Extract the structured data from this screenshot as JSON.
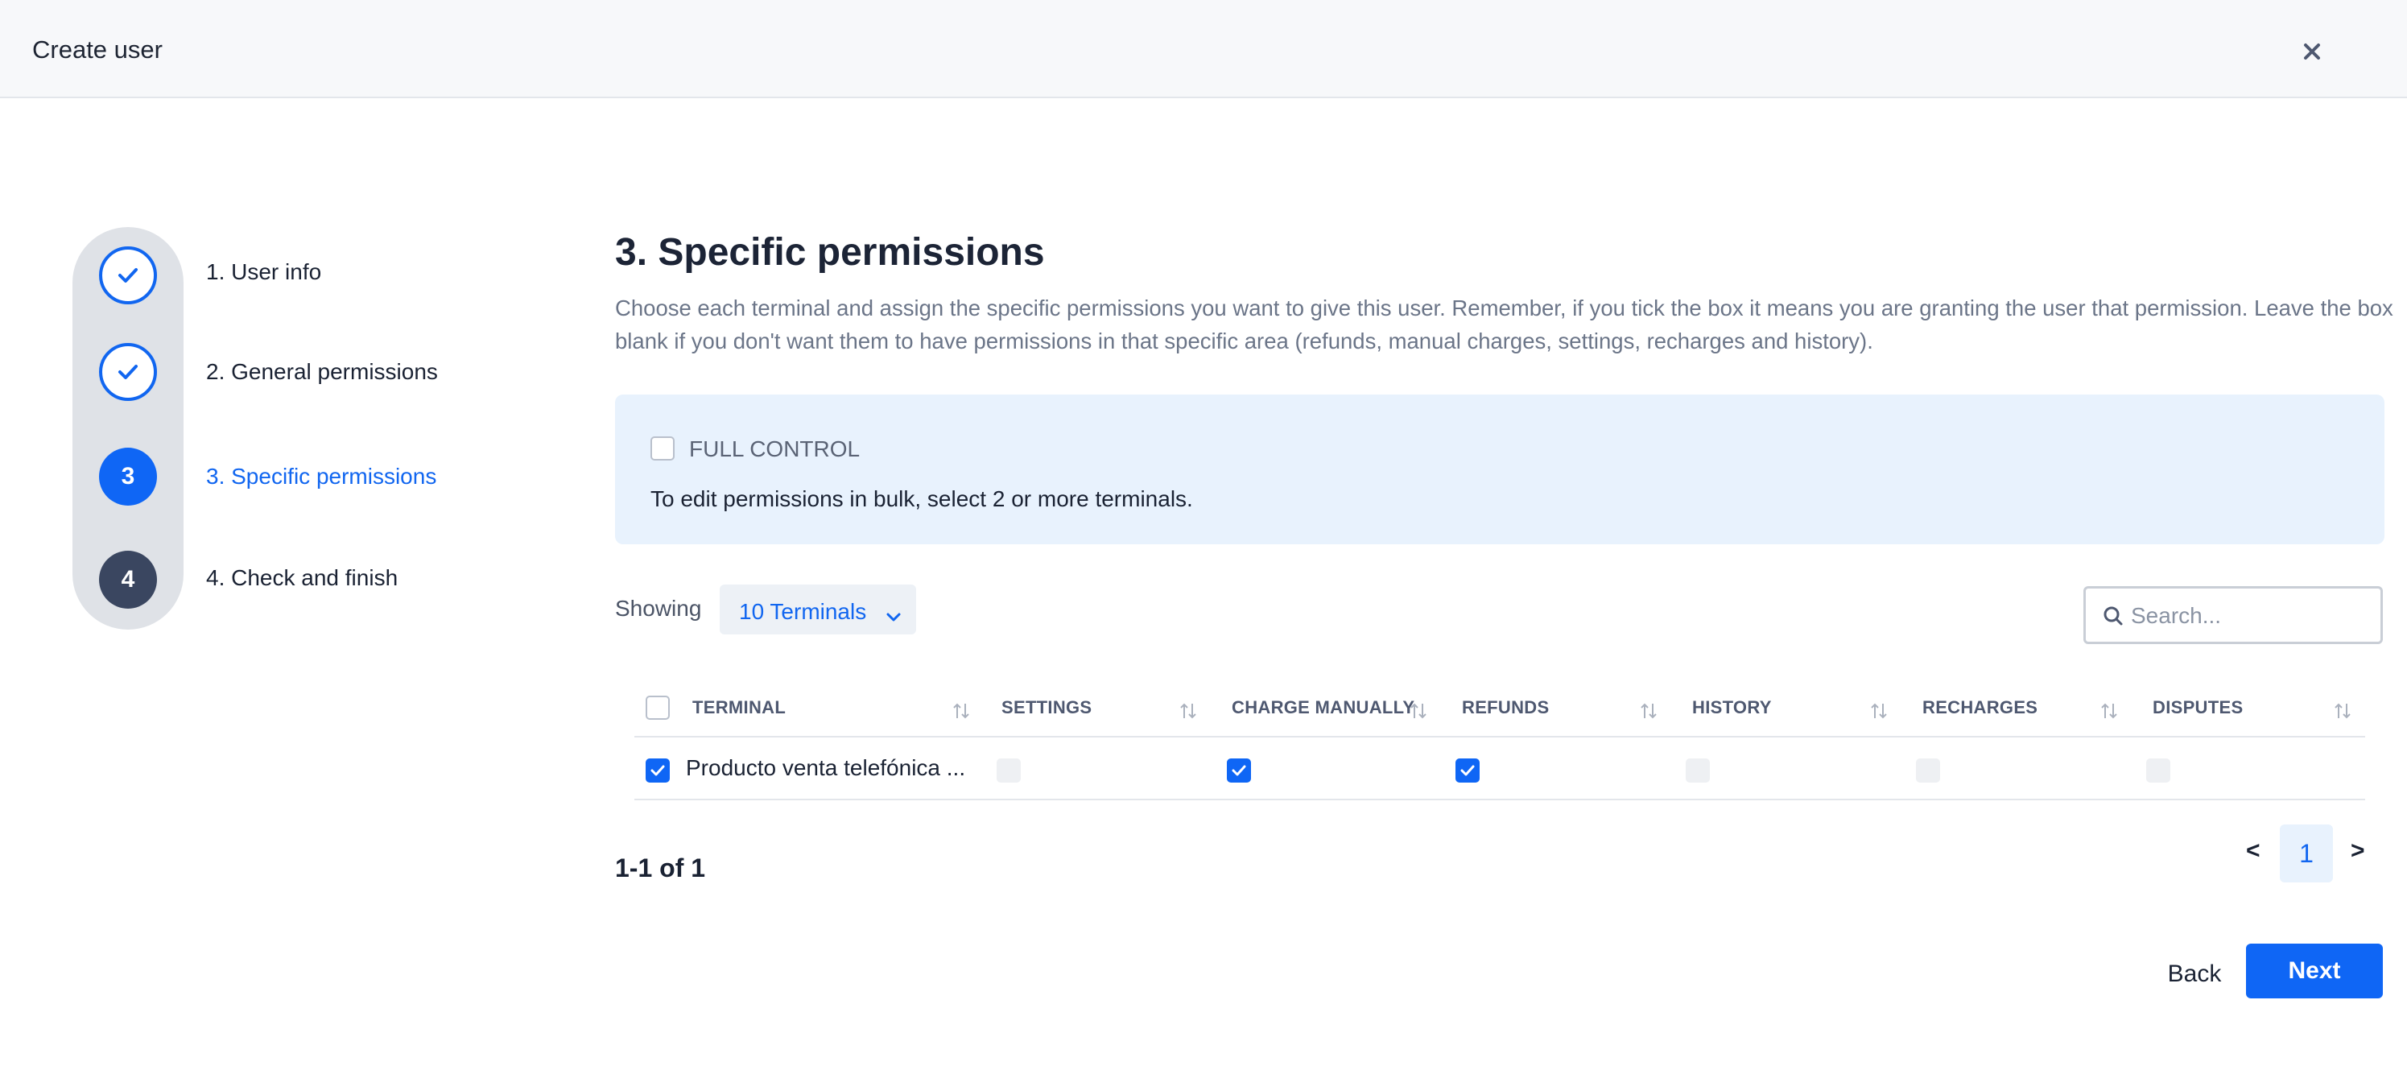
{
  "header": {
    "title": "Create user",
    "close_icon": "close-icon"
  },
  "colors": {
    "accent": "#0f66f5",
    "pending_step": "#3a4660",
    "info_bg": "#e8f2fd"
  },
  "stepper": {
    "steps": [
      {
        "number": "1",
        "label": "1. User info",
        "state": "done"
      },
      {
        "number": "2",
        "label": "2. General permissions",
        "state": "done"
      },
      {
        "number": "3",
        "label": "3. Specific permissions",
        "state": "active"
      },
      {
        "number": "4",
        "label": "4. Check and finish",
        "state": "pending"
      }
    ]
  },
  "main": {
    "title": "3. Specific permissions",
    "description": "Choose each terminal and assign the specific permissions you want to give this user. Remember, if you tick the box it means you are granting the user that permission. Leave the box blank if you don't want them to have permissions in that specific area (refunds, manual charges, settings, recharges and history).",
    "full_control": {
      "label": "FULL CONTROL",
      "checked": false
    },
    "bulk_text": "To edit permissions in bulk, select 2 or more terminals.",
    "showing_label": "Showing",
    "terminals_select": "10 Terminals",
    "search": {
      "placeholder": "Search...",
      "value": ""
    }
  },
  "table": {
    "columns": [
      "TERMINAL",
      "SETTINGS",
      "CHARGE MANUALLY",
      "REFUNDS",
      "HISTORY",
      "RECHARGES",
      "DISPUTES"
    ],
    "rows": [
      {
        "terminal": "Producto venta telefónica ...",
        "selected": true,
        "settings": false,
        "charge_manually": true,
        "refunds": true,
        "history": false,
        "recharges": false,
        "disputes": false
      }
    ]
  },
  "pagination": {
    "range": "1-1 of 1",
    "prev": "<",
    "next": ">",
    "current_page": "1"
  },
  "footer": {
    "back_label": "Back",
    "next_label": "Next"
  }
}
